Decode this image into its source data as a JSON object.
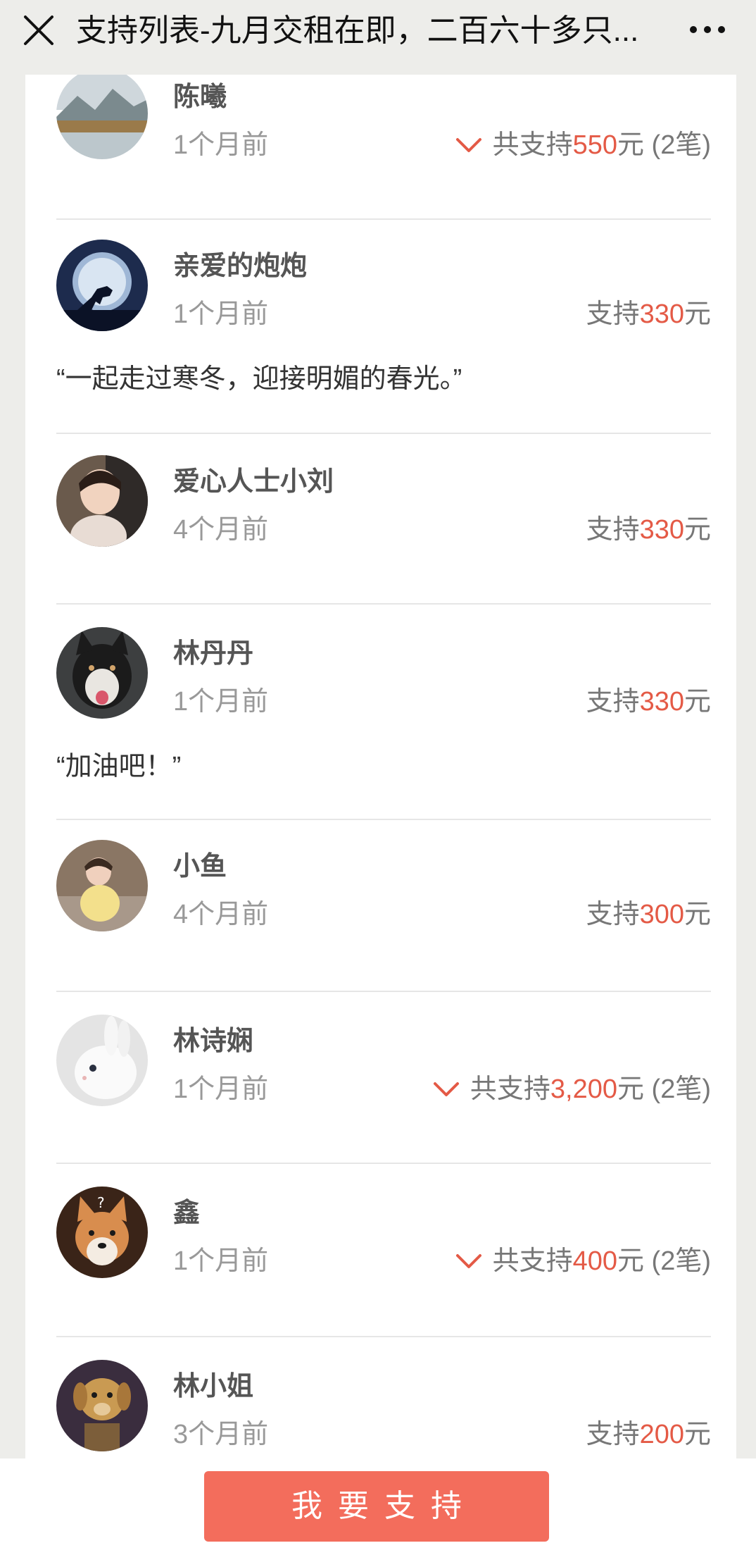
{
  "header": {
    "title": "支持列表-九月交租在即，二百六十多只..."
  },
  "entries": [
    {
      "name": "陈曦",
      "time": "1个月前",
      "prefix": "共支持",
      "amount": "550",
      "suffix": "元 (2笔)",
      "expandable": true,
      "comment": ""
    },
    {
      "name": "亲爱的炮炮",
      "time": "1个月前",
      "prefix": "支持",
      "amount": "330",
      "suffix": "元",
      "expandable": false,
      "comment": "“一起走过寒冬，迎接明媚的春光。”"
    },
    {
      "name": "爱心人士小刘",
      "time": "4个月前",
      "prefix": "支持",
      "amount": "330",
      "suffix": "元",
      "expandable": false,
      "comment": ""
    },
    {
      "name": "林丹丹",
      "time": "1个月前",
      "prefix": "支持",
      "amount": "330",
      "suffix": "元",
      "expandable": false,
      "comment": "“加油吧！”"
    },
    {
      "name": "小鱼",
      "time": "4个月前",
      "prefix": "支持",
      "amount": "300",
      "suffix": "元",
      "expandable": false,
      "comment": ""
    },
    {
      "name": "林诗娴",
      "time": "1个月前",
      "prefix": "共支持",
      "amount": "3,200",
      "suffix": "元 (2笔)",
      "expandable": true,
      "comment": ""
    },
    {
      "name": "鑫",
      "time": "1个月前",
      "prefix": "共支持",
      "amount": "400",
      "suffix": "元 (2笔)",
      "expandable": true,
      "comment": ""
    },
    {
      "name": "林小姐",
      "time": "3个月前",
      "prefix": "支持",
      "amount": "200",
      "suffix": "元",
      "expandable": false,
      "comment": ""
    }
  ],
  "footer": {
    "support_button": "我要支持"
  },
  "colors": {
    "accent": "#e45a46",
    "button": "#f36d5c"
  }
}
